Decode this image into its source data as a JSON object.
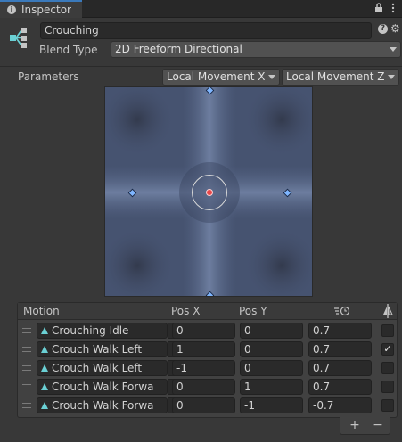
{
  "tab": {
    "label": "Inspector",
    "icon": "info-icon"
  },
  "header": {
    "name": "Crouching",
    "blend_type_label": "Blend Type",
    "blend_type_value": "2D Freeform Directional"
  },
  "parameters": {
    "label": "Parameters",
    "param_x": "Local Movement X",
    "param_z": "Local Movement Z"
  },
  "table": {
    "headers": {
      "motion": "Motion",
      "pos_x": "Pos X",
      "pos_y": "Pos Y"
    },
    "rows": [
      {
        "motion": "Crouching Idle",
        "pos_x": "0",
        "pos_y": "0",
        "speed": "0.7",
        "mirror": false
      },
      {
        "motion": "Crouch Walk Left",
        "pos_x": "1",
        "pos_y": "0",
        "speed": "0.7",
        "mirror": true
      },
      {
        "motion": "Crouch Walk Left",
        "pos_x": "-1",
        "pos_y": "0",
        "speed": "0.7",
        "mirror": false
      },
      {
        "motion": "Crouch Walk Forwa",
        "pos_x": "0",
        "pos_y": "1",
        "speed": "0.7",
        "mirror": false
      },
      {
        "motion": "Crouch Walk Forwa",
        "pos_x": "0",
        "pos_y": "-1",
        "speed": "-0.7",
        "mirror": false
      }
    ]
  },
  "footer": {
    "add": "+",
    "remove": "−"
  },
  "colors": {
    "accent": "#3a79bb",
    "point": "#7fb6ff",
    "selected_point": "#e8474a"
  }
}
